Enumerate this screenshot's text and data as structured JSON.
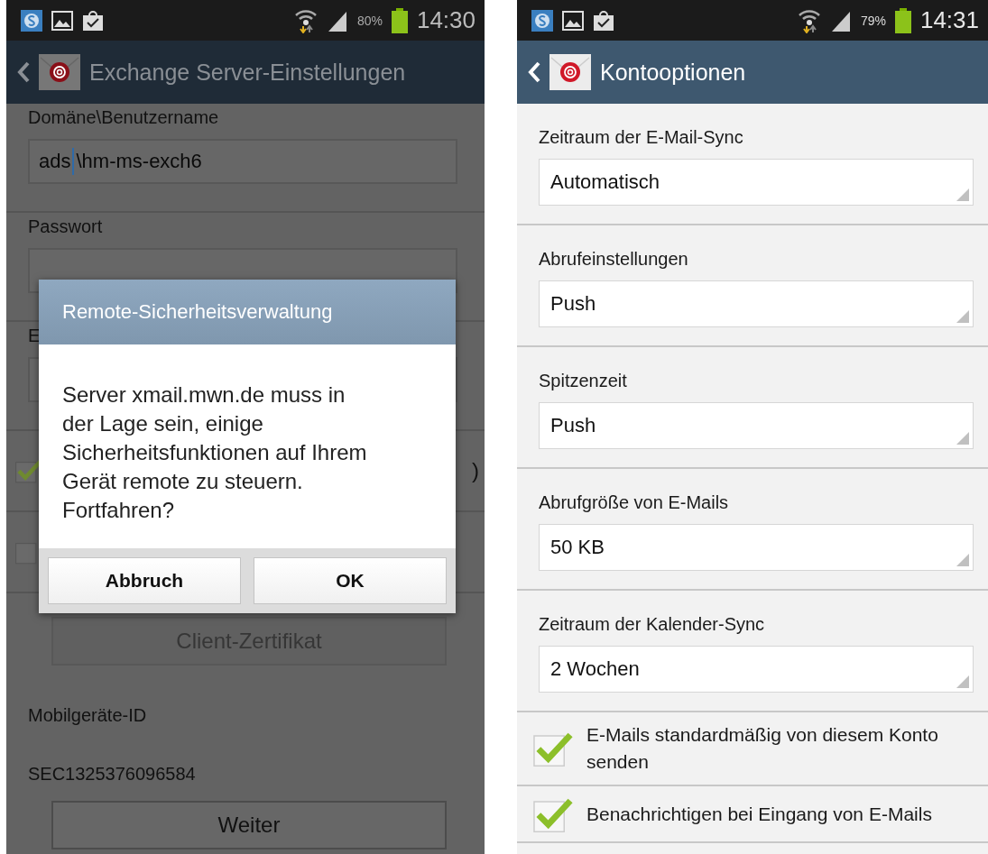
{
  "left_screen": {
    "status_bar": {
      "battery": "80%",
      "time": "14:30"
    },
    "title": "Exchange Server-Einstellungen",
    "form": [
      {
        "kind": "field",
        "label": "Domäne\\Benutzername",
        "value": "ads\\hm-ms-exch6"
      },
      {
        "kind": "field",
        "label": "Passwort"
      },
      {
        "kind": "field",
        "label": "E"
      },
      {
        "kind": "checkbox",
        "label": ")",
        "checked": true
      },
      {
        "kind": "checkbox",
        "checked": false
      },
      {
        "kind": "button",
        "label": "Client-Zertifikat",
        "disabled": true
      },
      {
        "kind": "info",
        "label": "Mobilgeräte-ID",
        "value": "SEC1325376096584"
      },
      {
        "kind": "button",
        "label": "Weiter",
        "disabled": false
      }
    ],
    "dialog": {
      "title": "Remote-Sicherheitsverwaltung",
      "message": "Server xmail.mwn.de muss in der Lage sein, einige Sicherheitsfunktionen auf Ihrem Gerät remote zu steuern. Fortfahren?",
      "buttons": [
        "Abbruch",
        "OK"
      ]
    }
  },
  "right_screen": {
    "status_bar": {
      "battery": "79%",
      "time": "14:31"
    },
    "title": "Kontooptionen",
    "options": [
      {
        "kind": "dropdown",
        "label": "Zeitraum der E-Mail-Sync",
        "value": "Automatisch"
      },
      {
        "kind": "dropdown",
        "label": "Abrufeinstellungen",
        "value": "Push"
      },
      {
        "kind": "dropdown",
        "label": "Spitzenzeit",
        "value": "Push"
      },
      {
        "kind": "dropdown",
        "label": "Abrufgröße von E-Mails",
        "value": "50 KB"
      },
      {
        "kind": "dropdown",
        "label": "Zeitraum der Kalender-Sync",
        "value": "2 Wochen"
      },
      {
        "kind": "checkbox",
        "label": "E-Mails standardmäßig von diesem Konto senden",
        "checked": true
      },
      {
        "kind": "checkbox",
        "label": "Benachrichtigen bei Eingang von E-Mails",
        "checked": true
      }
    ]
  }
}
